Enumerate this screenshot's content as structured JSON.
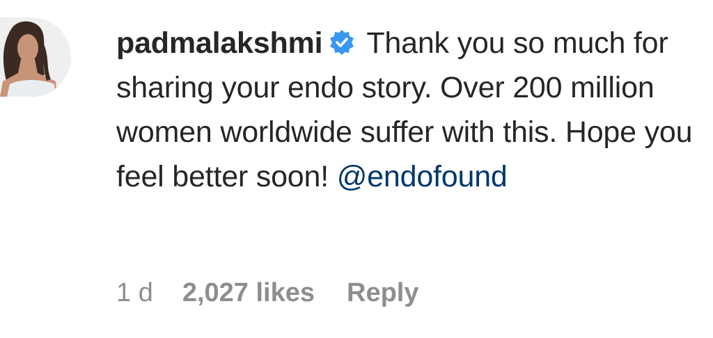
{
  "comment": {
    "avatar": "profile-photo",
    "username": "padmalakshmi",
    "verified_icon": "verified-badge-icon",
    "verified_color": "#3897f0",
    "text": "Thank you so much for sharing your endo story. Over 200 million women worldwide suffer with this. Hope you feel better soon!",
    "mention": "@endofound",
    "mention_color": "#00376b",
    "meta": {
      "time": "1 d",
      "likes": "2,027 likes",
      "reply": "Reply"
    }
  }
}
